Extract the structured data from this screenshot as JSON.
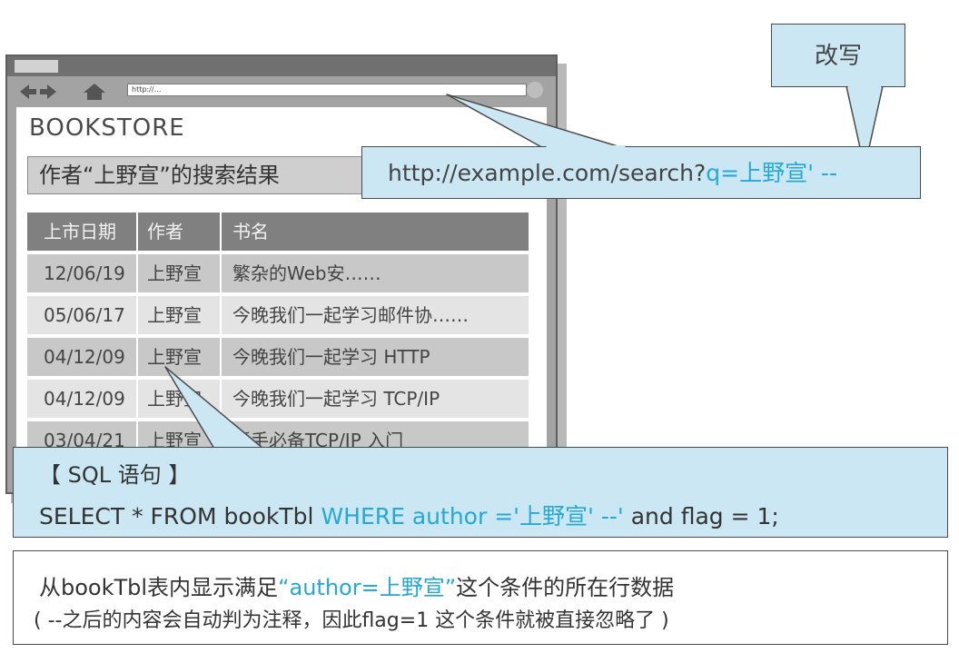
{
  "browser": {
    "address_text": "http://…",
    "store_title": "BOOKSTORE",
    "result_heading": "作者“上野宣”的搜索结果"
  },
  "table": {
    "headers": [
      "上市日期",
      "作者",
      "书名"
    ],
    "rows": [
      [
        "12/06/19",
        "上野宣",
        "繁杂的Web安……"
      ],
      [
        "05/06/17",
        "上野宣",
        "今晚我们一起学习邮件协……"
      ],
      [
        "04/12/09",
        "上野宣",
        "今晚我们一起学习 HTTP"
      ],
      [
        "04/12/09",
        "上野宣",
        "今晚我们一起学习 TCP/IP"
      ],
      [
        "03/04/21",
        "上野宣",
        "新手必备TCP/IP 入门"
      ]
    ]
  },
  "callouts": {
    "rewrite_label": "改写",
    "url_prefix": "http://example.com/search?",
    "url_param": "q=上野宣' --"
  },
  "sql": {
    "heading": "【 SQL 语句 】",
    "part1": "SELECT * FROM bookTbl ",
    "part2": "WHERE author ='上野宣' --'",
    "part3": " and flag = 1;"
  },
  "note": {
    "line1_a": "从bookTbl表内显示满足",
    "line1_b": "“author=上野宣”",
    "line1_c": "这个条件的所在行数据",
    "line2": "( --之后的内容会自动判为注释，因此flag=1 这个条件就被直接忽略了 )"
  },
  "colors": {
    "highlight": "#25a8d8",
    "callout_fill": "#cbe7f3"
  }
}
